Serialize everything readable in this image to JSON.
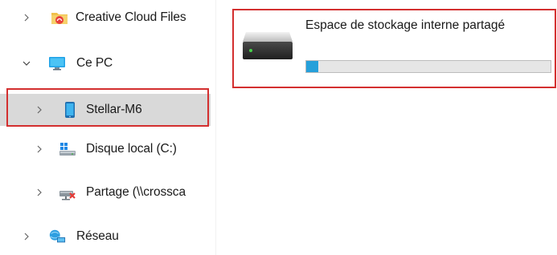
{
  "nav": {
    "items": [
      {
        "label": "Creative Cloud Files",
        "icon": "creative-cloud-folder-icon",
        "expanded": false
      },
      {
        "label": "Ce PC",
        "icon": "this-pc-icon",
        "expanded": true
      },
      {
        "label": "Stellar-M6",
        "icon": "phone-icon",
        "expanded": false,
        "selected": true
      },
      {
        "label": "Disque local (C:)",
        "icon": "windows-drive-icon",
        "expanded": false
      },
      {
        "label": "Partage (\\\\crossca",
        "icon": "disconnected-network-drive-icon",
        "expanded": false
      },
      {
        "label": "Réseau",
        "icon": "network-icon",
        "expanded": false
      }
    ]
  },
  "content": {
    "drive": {
      "name": "Espace de stockage interne partagé",
      "icon": "storage-drive-icon",
      "used_fraction": 0.05
    }
  },
  "colors": {
    "selection": "#d9d9d9",
    "highlight_box": "#d32f2f",
    "usage_bar_fill": "#26a0da",
    "usage_bar_track": "#e6e6e6"
  }
}
